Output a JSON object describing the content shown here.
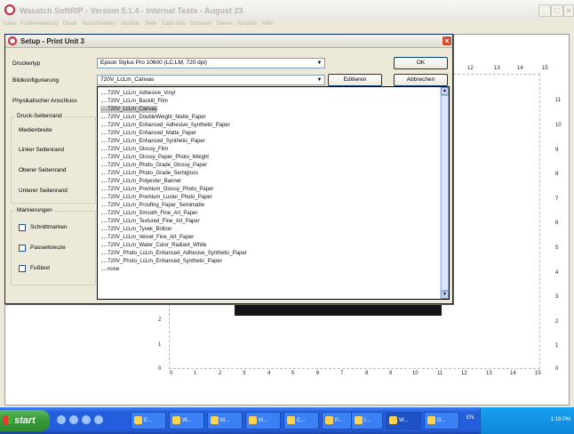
{
  "app": {
    "title": "Wasatch SoftRIP  - Version 5.1.4 - Internal Tests - August 23",
    "menu": [
      "Datei",
      "Farbverwaltung",
      "Druck",
      "Ausschneiden",
      "Variable",
      "Seite",
      "Datei-Info",
      "Optionen",
      "Server",
      "Sprache",
      "Hilfe"
    ]
  },
  "dialog": {
    "title": "Setup - Print Unit 3",
    "labels": {
      "druckertyp": "Druckertyp",
      "bildkonfiguration": "Bildkonfigurierung",
      "physikalischer": "Physikalischer Anschluss",
      "druck_seitenrand": "Druck-Seitenrand",
      "medienbreite": "Medienbreite",
      "linker": "Linker Seitenrand",
      "oberer": "Oberer Seitenrand",
      "unterer": "Unterer Seitenrand",
      "markierungen": "Markierungen",
      "schnittmarken": "Schnittmarken",
      "passerkreuze": "Passerkreuze",
      "fusstext": "Fußtext"
    },
    "printer_select": "Epson  Stylus Pro 10600 (LC,LM, 720 dpi)",
    "config_select": "720V_LcLm_Canvas",
    "buttons": {
      "ok": "OK",
      "abbrechen": "Abbrechen",
      "edit": "Editieren"
    }
  },
  "dropdown": {
    "selected_index": 2,
    "items": [
      "720V_LcLm_Adhesive_Vinyl",
      "720V_LcLm_Backlit_Film",
      "720V_LcLm_Canvas",
      "720V_LcLm_DoubleWeight_Matte_Paper",
      "720V_LcLm_Enhanced_Adhesive_Synthetic_Paper",
      "720V_LcLm_Enhanced_Matte_Paper",
      "720V_LcLm_Enhanced_Synthetic_Paper",
      "720V_LcLm_Glossy_Film",
      "720V_LcLm_Glossy_Paper_Photo_Weight",
      "720V_LcLm_Photo_Grade_Glossy_Paper",
      "720V_LcLm_Photo_Grade_Semigloss",
      "720V_LcLm_Polyester_Banner",
      "720V_LcLm_Premium_Glossy_Photo_Paper",
      "720V_LcLm_Premium_Luster_Photo_Paper",
      "720V_LcLm_Proofing_Paper_Semimatte",
      "720V_LcLm_Smooth_Fine_Art_Paper",
      "720V_LcLm_Textured_Fine_Art_Paper",
      "720V_LcLm_Tyvek_Brillion",
      "720V_LcLm_Velvet_Fine_Art_Paper",
      "720V_LcLm_Water_Color_Radiant_White",
      "720V_Photo_LcLm_Enhanced_Adhesive_Synthetic_Paper",
      "720V_Photo_LcLm_Enhanced_Synthetic_Paper",
      "none"
    ]
  },
  "rulers": {
    "horizontal": [
      "0",
      "1",
      "2",
      "3",
      "4",
      "5",
      "6",
      "7",
      "8",
      "9",
      "10",
      "11",
      "12",
      "13",
      "14",
      "15"
    ],
    "top": [
      "12",
      "13",
      "14",
      "15"
    ],
    "right": [
      "11",
      "10",
      "9",
      "8",
      "7",
      "6",
      "5",
      "4",
      "3",
      "2",
      "1",
      "0"
    ],
    "left": [
      "2",
      "1",
      "0"
    ]
  },
  "taskbar": {
    "start": "start",
    "buttons": [
      "E...",
      "W...",
      "M...",
      "M...",
      "C...",
      "P...",
      "I...",
      "W...",
      "G..."
    ],
    "lang": "EN",
    "clock": "1:19 PM"
  },
  "colors": {
    "accent": "#245edc",
    "close": "#d9492c",
    "start_green": "#3a9c3a"
  }
}
